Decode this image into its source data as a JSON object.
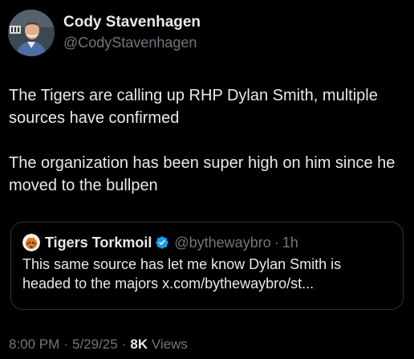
{
  "author": {
    "display_name": "Cody Stavenhagen",
    "handle": "@CodyStavenhagen"
  },
  "tweet": {
    "paragraph_1": "The Tigers are calling up RHP Dylan Smith, multiple sources have confirmed",
    "paragraph_2": "The organization has been super high on him since he moved to the bullpen"
  },
  "quote": {
    "display_name": "Tigers Torkmoil",
    "handle": "@bythewaybro",
    "dot": "·",
    "time": "1h",
    "text": "This same source has let me know Dylan Smith is headed to the majors x.com/bythewaybro/st..."
  },
  "meta": {
    "time": "8:00 PM",
    "sep1": "·",
    "date": "5/29/25",
    "sep2": "·",
    "views_count": "8K",
    "views_label": "Views"
  },
  "icons": {
    "verified": "verified-badge-icon",
    "avatar": "profile-photo",
    "quote_avatar": "tiger-logo"
  },
  "colors": {
    "background": "#000000",
    "text_primary": "#e7e9ea",
    "text_secondary": "#71767b",
    "border": "#2f3336",
    "verified_blue": "#1d9bf0"
  }
}
